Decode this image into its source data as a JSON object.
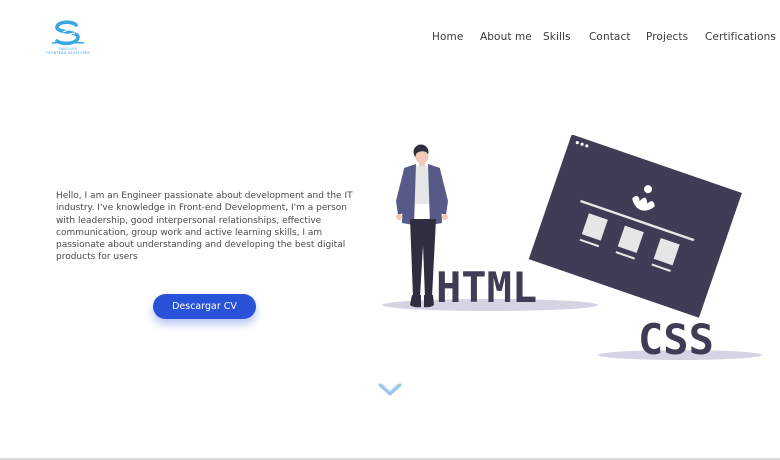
{
  "logo": {
    "caption_line1": "SANTIAGO",
    "caption_line2": "FRONTEND DEVELOPER"
  },
  "nav": {
    "items": [
      {
        "label": "Home"
      },
      {
        "label": "About me"
      },
      {
        "label": "Skills"
      },
      {
        "label": "Contact"
      },
      {
        "label": "Projects"
      },
      {
        "label": "Certifications"
      }
    ]
  },
  "hero": {
    "intro": "Hello, I am an Engineer passionate about development and the IT industry. I've knowledge in Front-end Development, I'm a person with leadership, good interpersonal relationships, effective communication, group work and active learning skills, I am passionate about understanding and developing the best digital products for users",
    "cv_button_label": "Descargar CV"
  },
  "illustration": {
    "label_html": "HTML",
    "label_css": "CSS"
  },
  "colors": {
    "accent": "#2853d9",
    "logo_blue": "#3aa7e0",
    "illustration_dark": "#3f3d56",
    "illustration_light": "#e6e6e6",
    "shadow": "#d6d3e4"
  },
  "icons": {
    "logo": "s-logo-icon",
    "scroll": "chevron-down-icon"
  }
}
